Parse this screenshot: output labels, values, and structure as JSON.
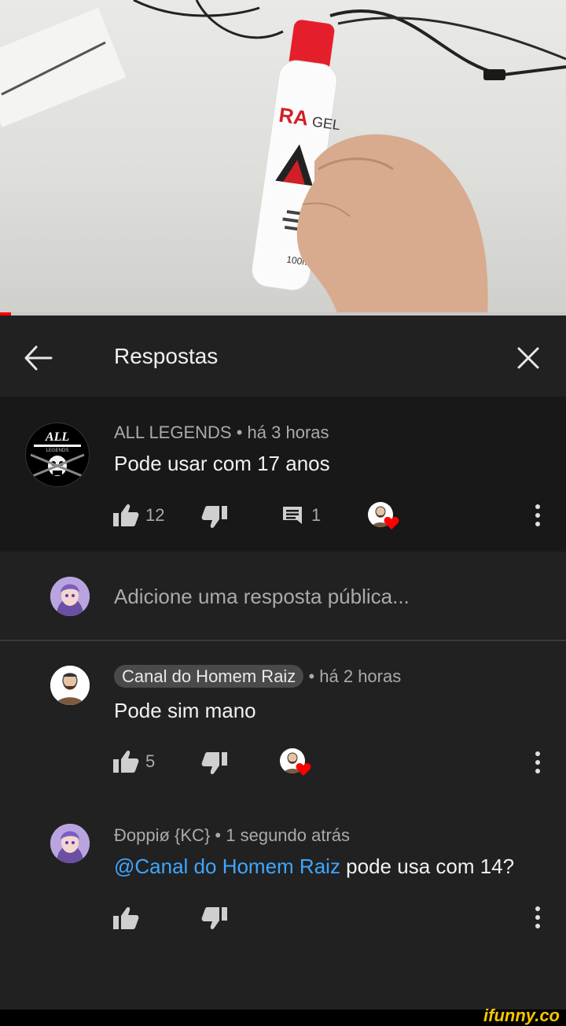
{
  "header": {
    "title": "Respostas"
  },
  "video": {
    "progress_fraction": 0.02,
    "accent": "#ff0000"
  },
  "parent_comment": {
    "author": "ALL LEGENDS",
    "time": "há 3 horas",
    "separator": "•",
    "text": "Pode usar com 17 anos",
    "likes": "12",
    "replies": "1"
  },
  "reply_input": {
    "placeholder": "Adicione uma resposta pública..."
  },
  "replies": [
    {
      "author": "Canal do Homem Raiz",
      "time": "há 2 horas",
      "separator": "•",
      "text": "Pode sim mano",
      "likes": "5"
    },
    {
      "author": "Ðoppiø {KC}",
      "time": "1 segundo atrás",
      "separator": "•",
      "mention": "@Canal do Homem Raiz",
      "text": " pode usa com 14?"
    }
  ],
  "watermark": "ifunny.co",
  "icons": [
    "back-arrow-icon",
    "close-icon",
    "thumb-up-icon",
    "thumb-down-icon",
    "reply-icon",
    "more-vert-icon",
    "creator-heart-icon"
  ],
  "colors": {
    "bg": "#212121",
    "bg_parent": "#181818",
    "text": "#f1f1f1",
    "meta": "#aaaaaa",
    "link": "#3ea6ff",
    "heart": "#ff0000"
  }
}
